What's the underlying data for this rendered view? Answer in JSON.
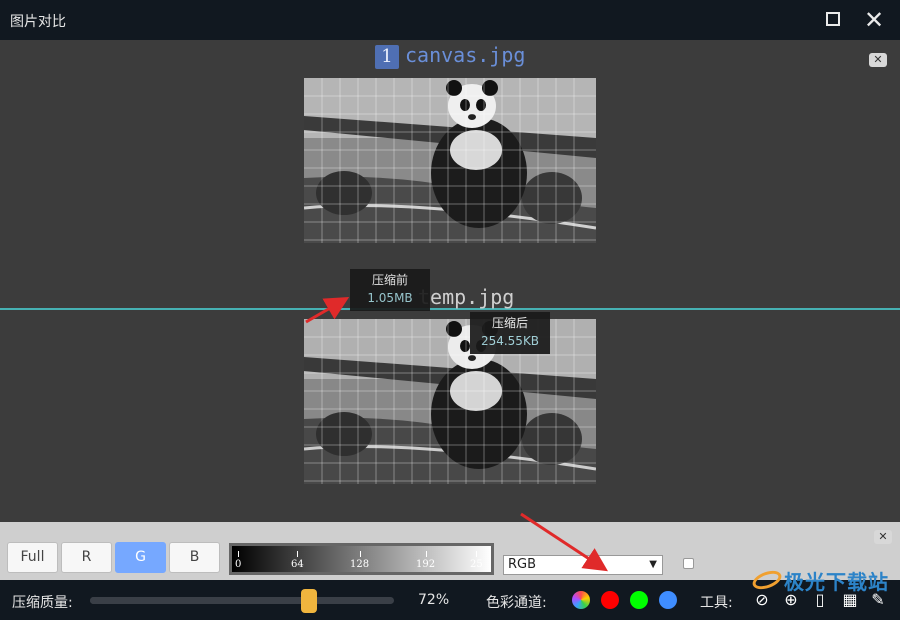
{
  "window": {
    "title": "图片对比"
  },
  "top_image": {
    "index": "1",
    "filename": "canvas.jpg"
  },
  "bottom_image": {
    "filename": "temp.jpg"
  },
  "tooltips": {
    "before": {
      "label": "压缩前",
      "value": "1.05MB"
    },
    "after": {
      "label": "压缩后",
      "value": "254.55KB"
    }
  },
  "channel_buttons": [
    {
      "label": "Full",
      "active": false
    },
    {
      "label": "R",
      "active": false
    },
    {
      "label": "G",
      "active": true
    },
    {
      "label": "B",
      "active": false
    }
  ],
  "histogram": {
    "ticks": [
      "0",
      "64",
      "128",
      "192",
      "25"
    ]
  },
  "color_mode_select": {
    "value": "RGB"
  },
  "status": {
    "quality_label": "压缩质量:",
    "quality_value": "72%",
    "quality_fraction": 0.72,
    "channel_label": "色彩通道:",
    "tools_label": "工具:"
  },
  "channel_dots": [
    {
      "name": "all-channels",
      "color": "multi"
    },
    {
      "name": "red",
      "color": "#ff0000"
    },
    {
      "name": "green",
      "color": "#00ff00"
    },
    {
      "name": "blue",
      "color": "#3f8dff"
    }
  ],
  "watermark": {
    "text": "极光下载站"
  },
  "colors": {
    "title_bar": "#111820",
    "divider": "#46b1b3",
    "active_button": "#76a8ff",
    "slider_thumb": "#f0b53e",
    "annotation_arrow": "#e02a2a"
  }
}
